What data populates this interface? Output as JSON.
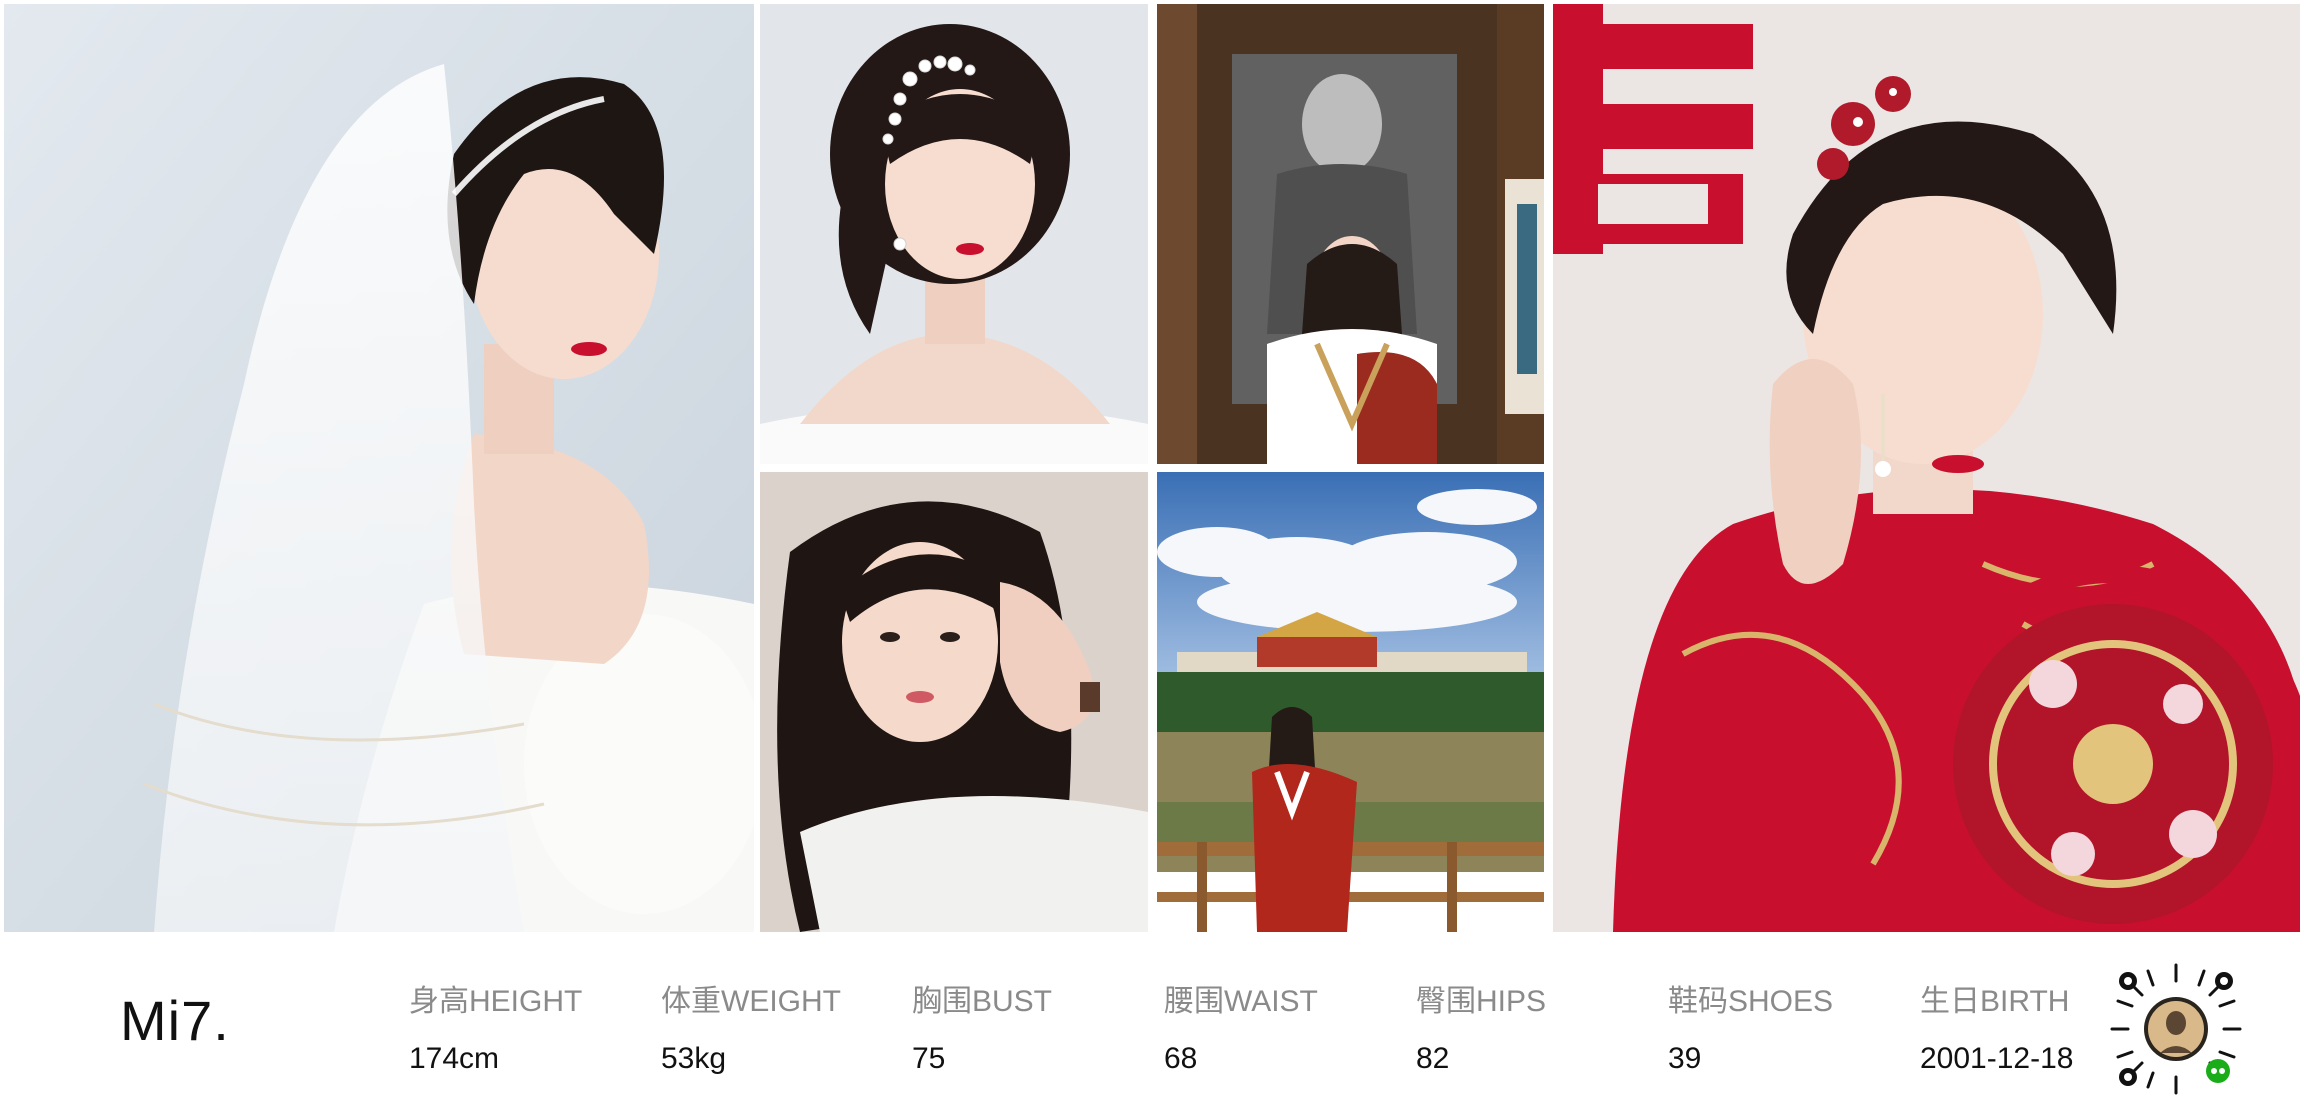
{
  "profile": {
    "name": "Mi7."
  },
  "stats": [
    {
      "label": "身高HEIGHT",
      "value": "174cm"
    },
    {
      "label": "体重WEIGHT",
      "value": "53kg"
    },
    {
      "label": "胸围BUST",
      "value": "75"
    },
    {
      "label": "腰围WAIST",
      "value": "68"
    },
    {
      "label": "臀围HIPS",
      "value": "82"
    },
    {
      "label": "鞋码SHOES",
      "value": "39"
    },
    {
      "label": "生日BIRTH",
      "value": "2001-12-18"
    }
  ],
  "colors": {
    "label_gray": "#8a8a8a",
    "text_dark": "#111111",
    "bridal_red": "#c8102e",
    "wechat_green": "#1aad19"
  },
  "icons": {
    "qr": "wechat-miniprogram-qr-icon"
  }
}
